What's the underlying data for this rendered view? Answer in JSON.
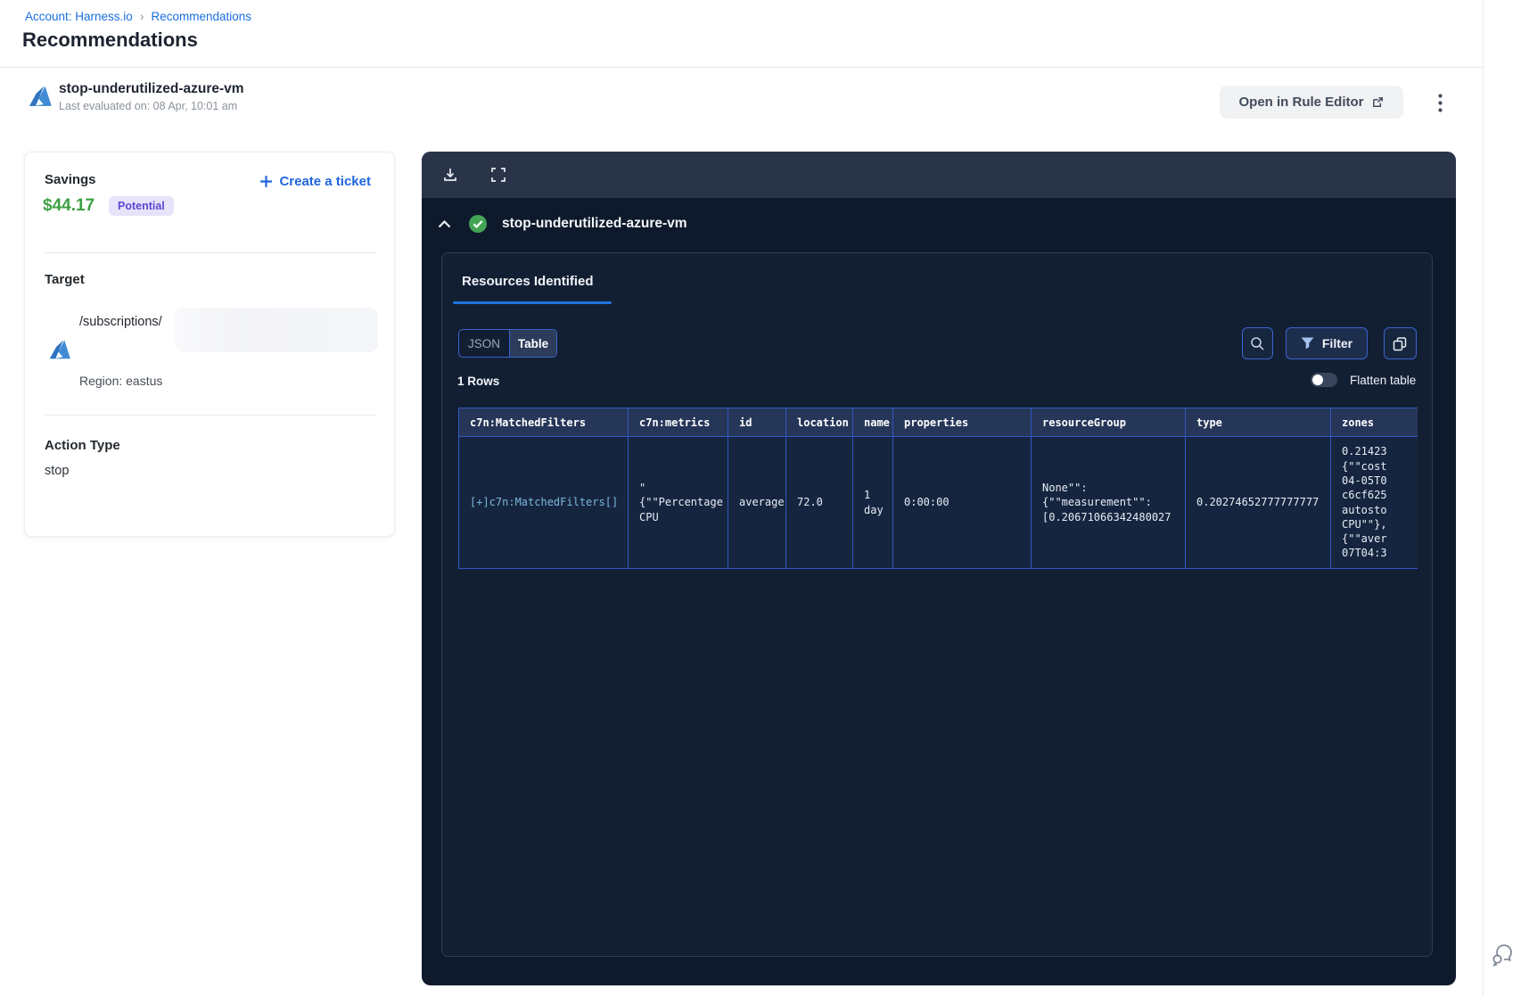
{
  "breadcrumb": {
    "account": "Account: Harness.io",
    "separator": "›",
    "current": "Recommendations"
  },
  "page": {
    "title": "Recommendations"
  },
  "recommendation_header": {
    "name": "stop-underutilized-azure-vm",
    "last_evaluated": "Last evaluated on: 08 Apr, 10:01 am",
    "open_in_rule_editor": "Open in Rule Editor"
  },
  "details_card": {
    "savings_label": "Savings",
    "savings_amount": "$44.17",
    "savings_badge": "Potential",
    "create_ticket": "Create a ticket",
    "target_label": "Target",
    "target_path": "/subscriptions/",
    "target_region": "Region: eastus",
    "action_type_label": "Action Type",
    "action_type_value": "stop"
  },
  "panel": {
    "title": "stop-underutilized-azure-vm",
    "tab": "Resources Identified",
    "view_toggle": {
      "json": "JSON",
      "table": "Table"
    },
    "filter_label": "Filter",
    "rows_count": "1 Rows",
    "flatten_label": "Flatten table",
    "table": {
      "columns": [
        "c7n:MatchedFilters",
        "c7n:metrics",
        "id",
        "location",
        "name",
        "properties",
        "resourceGroup",
        "type",
        "zones"
      ],
      "cells": [
        "[+]c7n:MatchedFilters[]",
        "\"\n{\"\"Percentage\nCPU",
        "average",
        "72.0",
        "1\nday",
        "0:00:00",
        "None\"\":\n{\"\"measurement\"\":\n[0.20671066342480027",
        "0.20274652777777777",
        "0.21423\n{\"\"cost\n04-05T0\nc6cf625\nautosto\nCPU\"\"},\n{\"\"aver\n07T04:3"
      ]
    }
  },
  "icons": [
    "azure-logo-icon",
    "download-icon",
    "fullscreen-icon",
    "collapse-chevron-icon",
    "success-check-icon",
    "search-icon",
    "filter-funnel-icon",
    "copy-icon",
    "external-link-icon",
    "kebab-menu-icon",
    "plus-icon",
    "chat-bubble-icon"
  ],
  "colors": {
    "link_blue": "#1b6fe0",
    "savings_green": "#3da044",
    "badge_bg": "#e7e3fb",
    "badge_text": "#5c49cf",
    "panel_bg": "#0e1a2b",
    "panel_toolbar_bg": "#2a3448",
    "card_bg": "#121f33",
    "table_border_blue": "#3157c2",
    "table_header_bg": "#263659",
    "table_row_bg": "#16253f",
    "tab_underline_blue": "#1f74e0",
    "success_green": "#43a454"
  }
}
